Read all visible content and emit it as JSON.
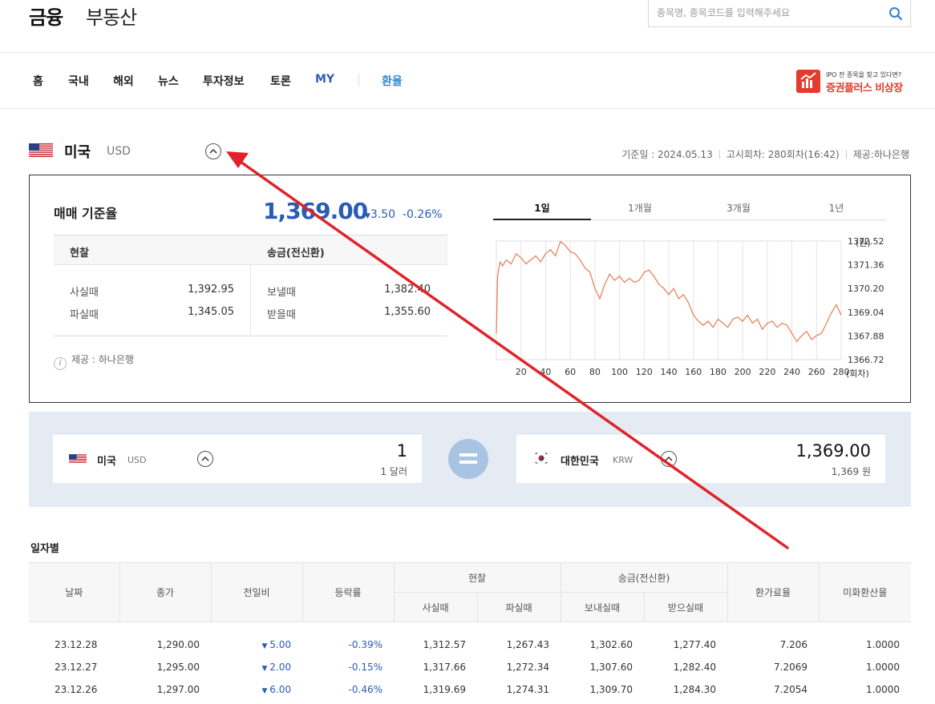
{
  "header": {
    "brand_primary": "금융",
    "brand_secondary": "부동산",
    "search_placeholder": "종목명, 종목코드를 입력해주세요"
  },
  "nav": {
    "items": [
      "홈",
      "국내",
      "해외",
      "뉴스",
      "투자정보",
      "토론",
      "MY",
      "환율"
    ],
    "ad_line1": "IPO 전 종목을 찾고 있다면?",
    "ad_line2": "증권플러스 비상장"
  },
  "currency": {
    "name": "미국",
    "code": "USD",
    "base_date": "기준일 : 2024.05.13",
    "notice": "고시회차: 280회차(16:42)",
    "provider_meta": "제공:하나은행"
  },
  "rate": {
    "label": "매매 기준율",
    "value": "1,369.00",
    "change": "3.50",
    "change_pct": "-0.26%",
    "cash_header": "현찰",
    "remit_header": "송금(전신환)",
    "buy_cash_label": "사실때",
    "buy_cash": "1,392.95",
    "sell_cash_label": "파실때",
    "sell_cash": "1,345.05",
    "send_label": "보낼때",
    "send": "1,382.40",
    "receive_label": "받을때",
    "receive": "1,355.60",
    "provider": "제공 : 하나은행"
  },
  "tabs": [
    "1일",
    "1개월",
    "3개월",
    "1년"
  ],
  "chart_data": {
    "type": "line",
    "color": "#e8794f",
    "y_unit_label": "(원)",
    "x_unit_label": "(회차)",
    "yticks": [
      1372.52,
      1371.36,
      1370.2,
      1369.04,
      1367.88,
      1366.72
    ],
    "ylim": [
      1366.72,
      1372.52
    ],
    "xticks": [
      20,
      40,
      60,
      80,
      100,
      120,
      140,
      160,
      180,
      200,
      220,
      240,
      260,
      280
    ],
    "xlim": [
      0,
      280
    ],
    "grid": "vertical",
    "series": [
      {
        "x": [
          0,
          1,
          3,
          5,
          8,
          12,
          16,
          20,
          24,
          28,
          32,
          36,
          40,
          44,
          48,
          52,
          56,
          60,
          64,
          68,
          72,
          76,
          80,
          84,
          88,
          92,
          96,
          100,
          104,
          108,
          112,
          116,
          120,
          124,
          128,
          132,
          136,
          140,
          144,
          148,
          152,
          156,
          160,
          164,
          168,
          172,
          176,
          180,
          184,
          188,
          192,
          196,
          200,
          204,
          208,
          212,
          216,
          220,
          224,
          228,
          232,
          236,
          240,
          244,
          248,
          252,
          256,
          260,
          264,
          268,
          272,
          276,
          280
        ],
        "y": [
          1368.0,
          1370.8,
          1371.5,
          1371.3,
          1371.6,
          1371.4,
          1371.9,
          1371.7,
          1371.4,
          1371.6,
          1371.8,
          1371.5,
          1371.9,
          1372.1,
          1371.8,
          1372.5,
          1372.3,
          1372.0,
          1371.9,
          1371.6,
          1371.2,
          1371.0,
          1370.2,
          1369.7,
          1370.4,
          1370.9,
          1370.6,
          1370.8,
          1370.5,
          1370.7,
          1370.5,
          1370.6,
          1371.0,
          1371.1,
          1370.8,
          1370.4,
          1370.2,
          1369.9,
          1370.2,
          1369.7,
          1369.9,
          1369.5,
          1368.9,
          1368.6,
          1368.4,
          1368.6,
          1368.3,
          1368.7,
          1368.5,
          1368.3,
          1368.7,
          1368.8,
          1368.6,
          1368.9,
          1368.5,
          1368.7,
          1368.2,
          1368.5,
          1368.6,
          1368.3,
          1368.5,
          1368.4,
          1368.0,
          1367.6,
          1367.9,
          1368.1,
          1367.7,
          1367.9,
          1368.0,
          1368.5,
          1369.0,
          1369.4,
          1368.9
        ]
      }
    ]
  },
  "converter": {
    "from_name": "미국",
    "from_code": "USD",
    "from_amount": "1",
    "from_sub": "1 달러",
    "to_name": "대한민국",
    "to_code": "KRW",
    "to_amount": "1,369.00",
    "to_sub": "1,369 원"
  },
  "daily": {
    "title": "일자별",
    "headers": {
      "date": "날짜",
      "close": "종가",
      "prev": "전일비",
      "pct": "등락률",
      "cash": "현찰",
      "cash_buy": "사실때",
      "cash_sell": "파실때",
      "remit": "송금(전신환)",
      "remit_send": "보내실때",
      "remit_recv": "받으실때",
      "exch_rate": "환가료율",
      "usd_rate": "미화환산율"
    },
    "rows": [
      [
        "23.12.28",
        "1,290.00",
        "5.00",
        "-0.39%",
        "1,312.57",
        "1,267.43",
        "1,302.60",
        "1,277.40",
        "7.206",
        "1.0000"
      ],
      [
        "23.12.27",
        "1,295.00",
        "2.00",
        "-0.15%",
        "1,317.66",
        "1,272.34",
        "1,307.60",
        "1,282.40",
        "7.2069",
        "1.0000"
      ],
      [
        "23.12.26",
        "1,297.00",
        "6.00",
        "-0.46%",
        "1,319.69",
        "1,274.31",
        "1,309.70",
        "1,284.30",
        "7.2054",
        "1.0000"
      ]
    ]
  }
}
